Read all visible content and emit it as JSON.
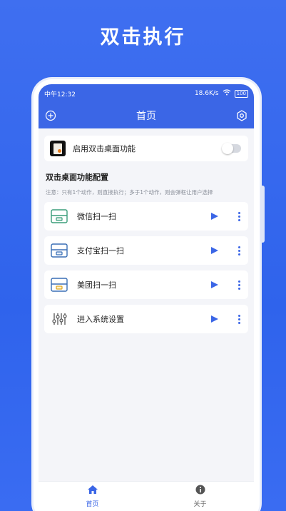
{
  "promo": {
    "title": "双击执行"
  },
  "status": {
    "time": "中午12:32",
    "speed": "18.6K/s",
    "battery": "100"
  },
  "appbar": {
    "title": "首页"
  },
  "enable": {
    "label": "启用双击桌面功能",
    "enabled": false
  },
  "section": {
    "title": "双击桌面功能配置",
    "note": "注意：只有1个动作，则直接执行；多于1个动作，则会弹框让用户选择"
  },
  "actions": [
    {
      "label": "微信扫一扫",
      "icon": "scan-icon"
    },
    {
      "label": "支付宝扫一扫",
      "icon": "scan-icon"
    },
    {
      "label": "美团扫一扫",
      "icon": "scan-icon"
    },
    {
      "label": "进入系统设置",
      "icon": "sliders-icon"
    }
  ],
  "nav": [
    {
      "label": "首页",
      "icon": "home-icon",
      "active": true
    },
    {
      "label": "关于",
      "icon": "info-icon",
      "active": false
    }
  ],
  "colors": {
    "accent": "#3b66e6",
    "background": "#2f63ec"
  }
}
